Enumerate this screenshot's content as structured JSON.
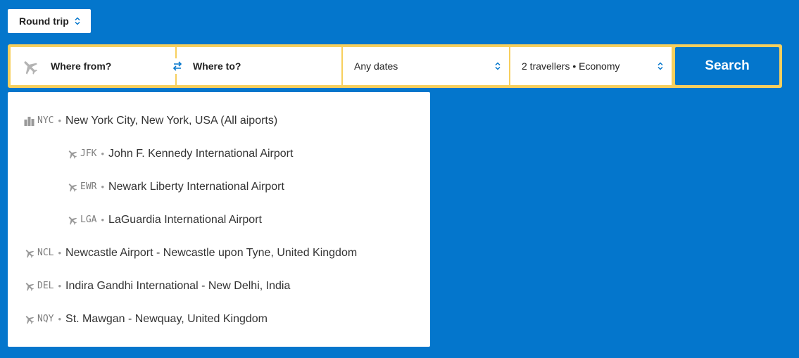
{
  "trip_type": {
    "label": "Round trip"
  },
  "search_form": {
    "from_placeholder": "Where from?",
    "to_placeholder": "Where to?",
    "dates_label": "Any dates",
    "travellers_label": "2 travellers • Economy",
    "search_label": "Search"
  },
  "colors": {
    "background": "#0476cc",
    "form_border": "#f7cf5d",
    "accent": "#0476cc",
    "icon_gray": "#9a9a9a"
  },
  "suggestions": [
    {
      "icon": "city-icon",
      "code": "NYC",
      "name": "New York City, New York, USA (All aiports)",
      "level": "top"
    },
    {
      "icon": "plane-icon",
      "code": "JFK",
      "name": "John F. Kennedy International Airport",
      "level": "sub"
    },
    {
      "icon": "plane-icon",
      "code": "EWR",
      "name": "Newark Liberty International Airport",
      "level": "sub"
    },
    {
      "icon": "plane-icon",
      "code": "LGA",
      "name": "LaGuardia International Airport",
      "level": "sub"
    },
    {
      "icon": "plane-icon",
      "code": "NCL",
      "name": "Newcastle Airport - Newcastle upon Tyne, United Kingdom",
      "level": "top"
    },
    {
      "icon": "plane-icon",
      "code": "DEL",
      "name": "Indira Gandhi International - New Delhi, India",
      "level": "top"
    },
    {
      "icon": "plane-icon",
      "code": "NQY",
      "name": "St. Mawgan - Newquay, United Kingdom",
      "level": "top"
    }
  ]
}
